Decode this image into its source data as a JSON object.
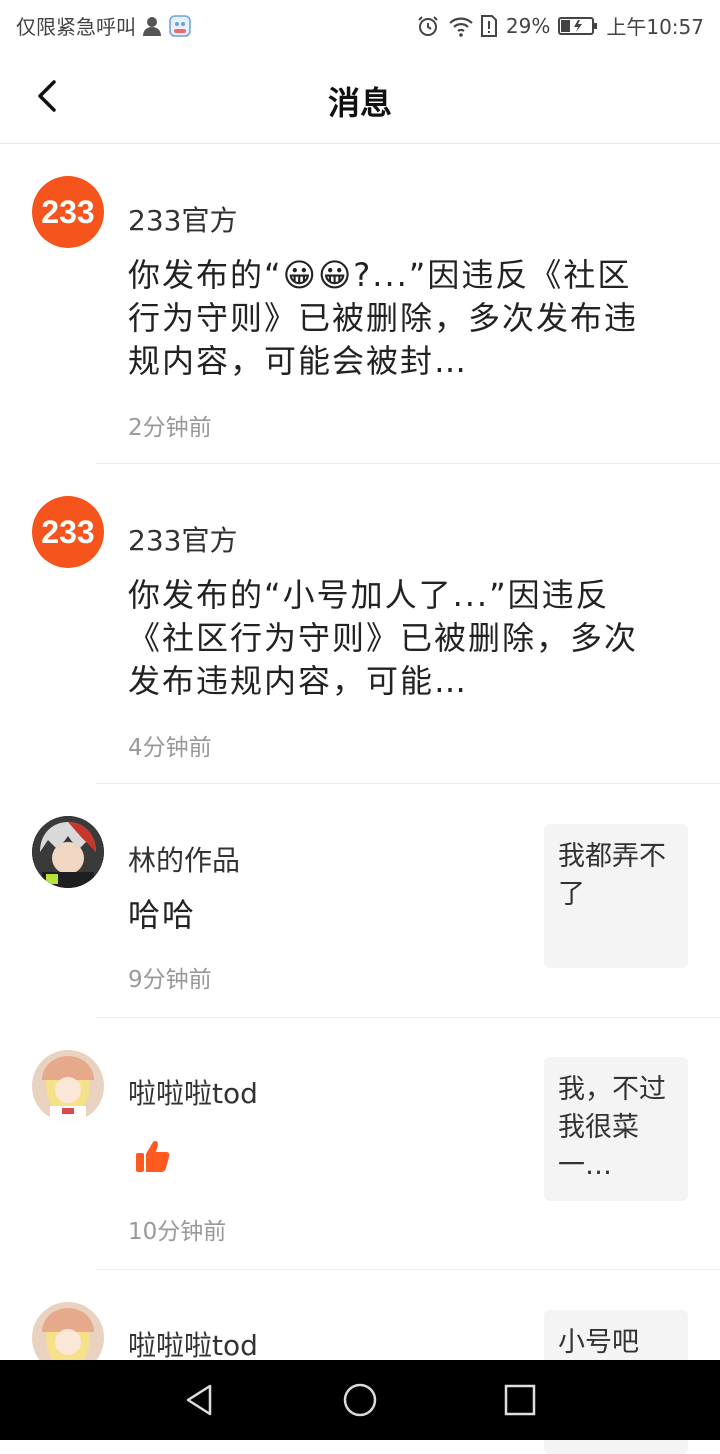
{
  "status_bar": {
    "carrier": "仅限紧急呼叫",
    "battery": "29%",
    "time": "上午10:57"
  },
  "header": {
    "title": "消息"
  },
  "messages": [
    {
      "sender": "233官方",
      "avatar_text": "233",
      "content": "你发布的“😀😀?...”因违反《社区行为守则》已被删除，多次发布违规内容，可能会被封…",
      "time": "2分钟前"
    },
    {
      "sender": "233官方",
      "avatar_text": "233",
      "content": "你发布的“小号加人了...”因违反《社区行为守则》已被删除，多次发布违规内容，可能…",
      "time": "4分钟前"
    },
    {
      "sender": "林的作品",
      "content": "哈哈",
      "time": "9分钟前",
      "thumb_text": "我都弄不了"
    },
    {
      "sender": "啦啦啦tod",
      "content_icon": "thumbs-up-icon",
      "time": "10分钟前",
      "thumb_text": "我，不过我很菜一…"
    },
    {
      "sender": "啦啦啦tod",
      "thumb_text": "小号吧"
    }
  ],
  "colors": {
    "brand_orange": "#f5541d",
    "like_orange": "#ff5a1f"
  }
}
